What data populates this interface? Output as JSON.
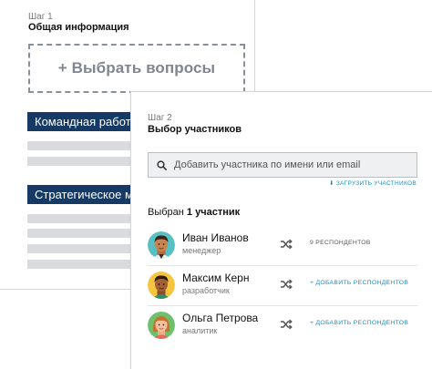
{
  "step1": {
    "label": "Шаг 1",
    "title": "Общая информация",
    "choose_button": "+ Выбрать вопросы",
    "sections": [
      {
        "label": "Командная работа"
      },
      {
        "label": "Стратегическое мышление"
      }
    ]
  },
  "step2": {
    "label": "Шаг 2",
    "title": "Выбор участников",
    "search": {
      "placeholder": "Добавить участника по имени или email",
      "icon": "search-icon"
    },
    "upload_link": "⬇ ЗАГРУЗИТЬ УЧАСТНИКОВ",
    "selected": {
      "prefix": "Выбран",
      "count": "1 участник"
    },
    "participants": [
      {
        "name": "Иван Иванов",
        "role": "менеджер",
        "respondents": "9 РЕСПОНДЕНТОВ",
        "respondents_is_link": false
      },
      {
        "name": "Максим Керн",
        "role": "разработчик",
        "respondents": "+ ДОБАВИТЬ РЕСПОНДЕНТОВ",
        "respondents_is_link": true
      },
      {
        "name": "Ольга Петрова",
        "role": "аналитик",
        "respondents": "+ ДОБАВИТЬ РЕСПОНДЕНТОВ",
        "respondents_is_link": true
      }
    ]
  },
  "colors": {
    "section_bar": "#163a63",
    "link": "#1d8fc5",
    "placeholder_gray": "#d9dbde"
  }
}
